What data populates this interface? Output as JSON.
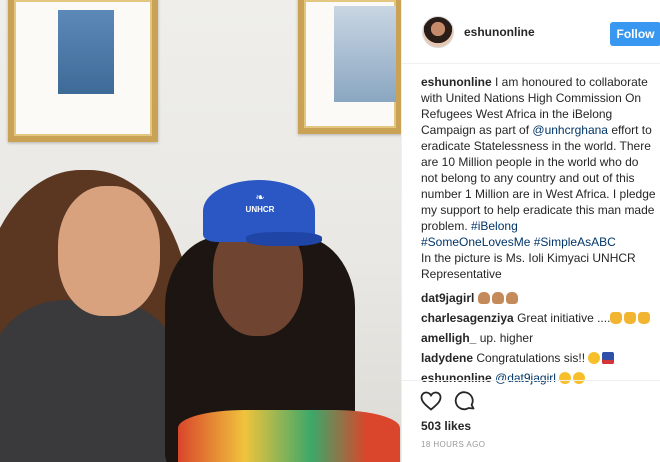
{
  "header": {
    "username": "eshunonline",
    "follow_label": "Follow"
  },
  "caption": {
    "author": "eshunonline",
    "text_1": "I am honoured to collaborate with United Nations High Commission On Refugees West Africa in the iBelong Campaign as part of",
    "mention": "@unhcrghana",
    "text_2": "effort to eradicate Statelessness in the world. There are 10 Million people in the world who do not belong to any country and out of this number 1 Million are in West Africa. I pledge my support to help eradicate this man made problem.",
    "hashtag_1": "#iBelong",
    "hashtag_2": "#SomeOneLovesMe",
    "hashtag_3": "#SimpleAsABC",
    "text_3": "In the picture is Ms. Ioli Kimyaci UNHCR Representative"
  },
  "comments": [
    {
      "user": "dat9jagirl",
      "text": "",
      "emoji": [
        "clap-emoji",
        "clap-emoji",
        "clap-emoji"
      ]
    },
    {
      "user": "charlesagenziya",
      "text": "Great initiative ....",
      "emoji": [
        "thumbs-up-emoji",
        "thumbs-up-emoji",
        "thumbs-up-emoji"
      ]
    },
    {
      "user": "amelligh_",
      "text": "up. higher",
      "emoji": []
    },
    {
      "user": "ladydene",
      "text": "Congratulations sis!!",
      "emoji": [
        "kiss-emoji",
        "gift-emoji"
      ]
    },
    {
      "user": "eshunonline",
      "mention": "@dat9jagirl",
      "text": "",
      "emoji": [
        "kiss-emoji",
        "kiss-emoji"
      ]
    }
  ],
  "photo": {
    "cap_text": "UNHCR"
  },
  "actions": {
    "likes": "503 likes",
    "timestamp": "18 HOURS AGO",
    "icons": [
      "heart-icon",
      "comment-icon"
    ]
  },
  "colors": {
    "follow_button": "#3897f0",
    "link": "#003569",
    "text": "#262626",
    "muted": "#999999"
  }
}
